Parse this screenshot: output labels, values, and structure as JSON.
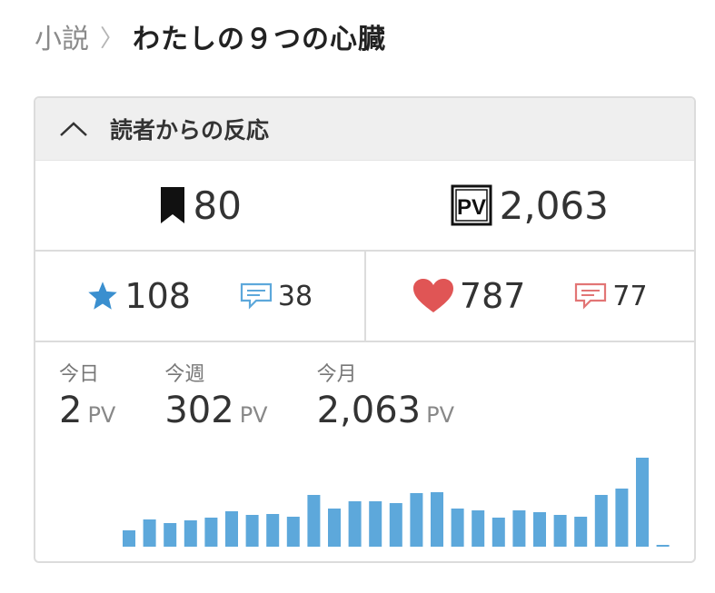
{
  "breadcrumb": {
    "parent": "小説",
    "separator": "〉",
    "title": "わたしの９つの心臓"
  },
  "panel": {
    "header": "読者からの反応",
    "bookmarks": "80",
    "pv_total": "2,063",
    "stars": "108",
    "star_comments": "38",
    "hearts": "787",
    "heart_comments": "77"
  },
  "stats": {
    "unit": "PV",
    "today": {
      "label": "今日",
      "value": "2"
    },
    "week": {
      "label": "今週",
      "value": "302"
    },
    "month": {
      "label": "今月",
      "value": "2,063"
    }
  },
  "colors": {
    "bar": "#5da8db",
    "star": "#3a8fcf",
    "heart": "#e05555",
    "star_comment": "#5da8db",
    "heart_comment": "#e27575"
  },
  "chart_data": {
    "type": "bar",
    "title": "",
    "xlabel": "",
    "ylabel": "",
    "values": [
      18,
      30,
      26,
      29,
      32,
      39,
      35,
      36,
      33,
      57,
      42,
      50,
      50,
      48,
      59,
      60,
      42,
      40,
      32,
      40,
      38,
      35,
      33,
      57,
      64,
      98,
      2
    ]
  }
}
